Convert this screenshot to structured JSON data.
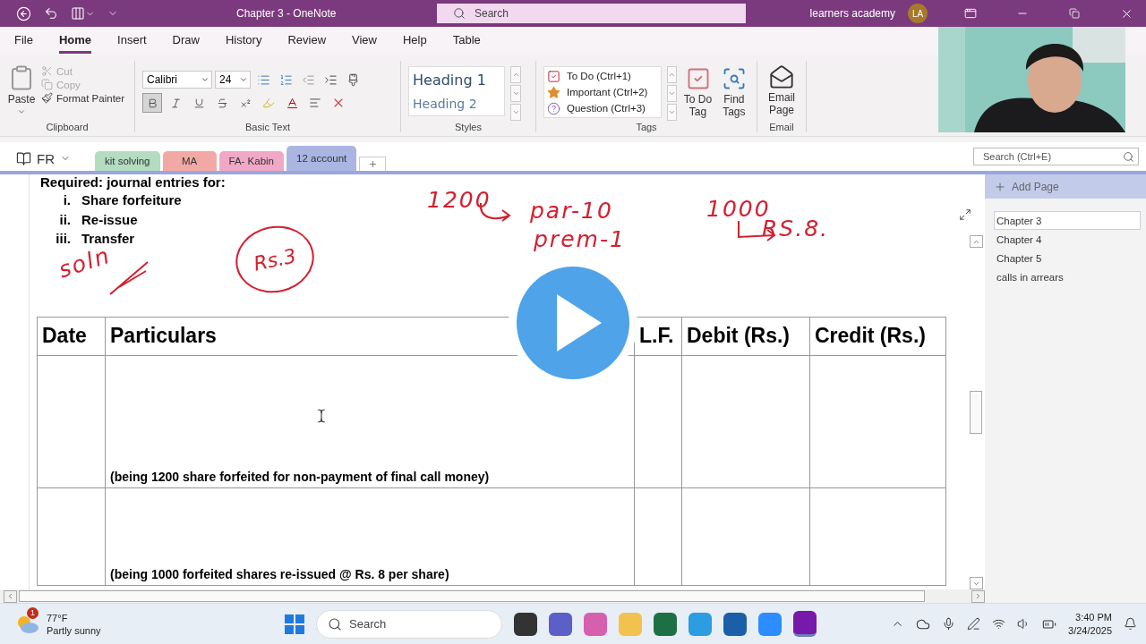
{
  "title_bar": {
    "title": "Chapter 3  -  OneNote",
    "search": {
      "placeholder": "Search"
    },
    "account": "learners academy",
    "avatar": "LA"
  },
  "menu_tabs": [
    {
      "label": "File",
      "selected": false
    },
    {
      "label": "Home",
      "selected": true
    },
    {
      "label": "Insert",
      "selected": false
    },
    {
      "label": "Draw",
      "selected": false
    },
    {
      "label": "History",
      "selected": false
    },
    {
      "label": "Review",
      "selected": false
    },
    {
      "label": "View",
      "selected": false
    },
    {
      "label": "Help",
      "selected": false
    },
    {
      "label": "Table",
      "selected": false
    }
  ],
  "clipboard": {
    "label": "Clipboard",
    "paste": "Paste",
    "cut": {
      "label": "Cut",
      "disabled": true
    },
    "copy": {
      "label": "Copy",
      "disabled": true
    },
    "format_painter": "Format Painter"
  },
  "basic_text": {
    "label": "Basic Text",
    "font": "Calibri",
    "size": "24",
    "bold": true
  },
  "styles": {
    "label": "Styles",
    "items": [
      "Heading 1",
      "Heading 2"
    ]
  },
  "tags": {
    "label": "Tags",
    "items": [
      {
        "kind": "todo",
        "label": "To Do (Ctrl+1)"
      },
      {
        "kind": "important",
        "label": "Important (Ctrl+2)"
      },
      {
        "kind": "question",
        "label": "Question (Ctrl+3)"
      }
    ],
    "todo_tag": "To Do Tag",
    "find_tags": "Find Tags"
  },
  "email": {
    "label": "Email",
    "button": "Email Page"
  },
  "notebook": {
    "name": "FR",
    "sections": [
      {
        "label": "kit solving",
        "color": "#b3dcc0",
        "selected": false
      },
      {
        "label": "MA",
        "color": "#f2a9a6",
        "selected": false
      },
      {
        "label": "FA- Kabin",
        "color": "#f0a8c6",
        "selected": false
      },
      {
        "label": "12 account",
        "color": "#aab5e2",
        "selected": true
      }
    ],
    "search": {
      "placeholder": "Search (Ctrl+E)"
    }
  },
  "page": {
    "heading": "Required: journal entries for:",
    "list": [
      {
        "marker": "i.",
        "text": "Share forfeiture"
      },
      {
        "marker": "ii.",
        "text": "Re-issue"
      },
      {
        "marker": "iii.",
        "text": "Transfer"
      }
    ],
    "ink": [
      {
        "text": "soln"
      },
      {
        "text": "Rs.3",
        "circled": true
      },
      {
        "text": "1200"
      },
      {
        "text": "par-10"
      },
      {
        "text": "prem-1"
      },
      {
        "text": "1000"
      },
      {
        "text": "RS.8."
      }
    ],
    "table": {
      "columns": [
        "Date",
        "Particulars",
        "L.F.",
        "Debit (Rs.)",
        "Credit (Rs.)"
      ],
      "rows": [
        {
          "narration": "(being 1200 share forfeited for non-payment of final call money)"
        },
        {
          "narration": "(being 1000 forfeited shares re-issued @ Rs. 8 per share)"
        }
      ]
    }
  },
  "pages_pane": {
    "add_page": "Add Page",
    "pages": [
      {
        "label": "Chapter 3",
        "selected": true
      },
      {
        "label": "Chapter 4",
        "selected": false
      },
      {
        "label": "Chapter 5",
        "selected": false
      },
      {
        "label": "calls in arrears",
        "selected": false
      }
    ]
  },
  "taskbar": {
    "weather": {
      "badge": "1",
      "temp": "77°F",
      "desc": "Partly sunny"
    },
    "search": {
      "placeholder": "Search"
    },
    "time": "3:40 PM",
    "date": "3/24/2025"
  }
}
